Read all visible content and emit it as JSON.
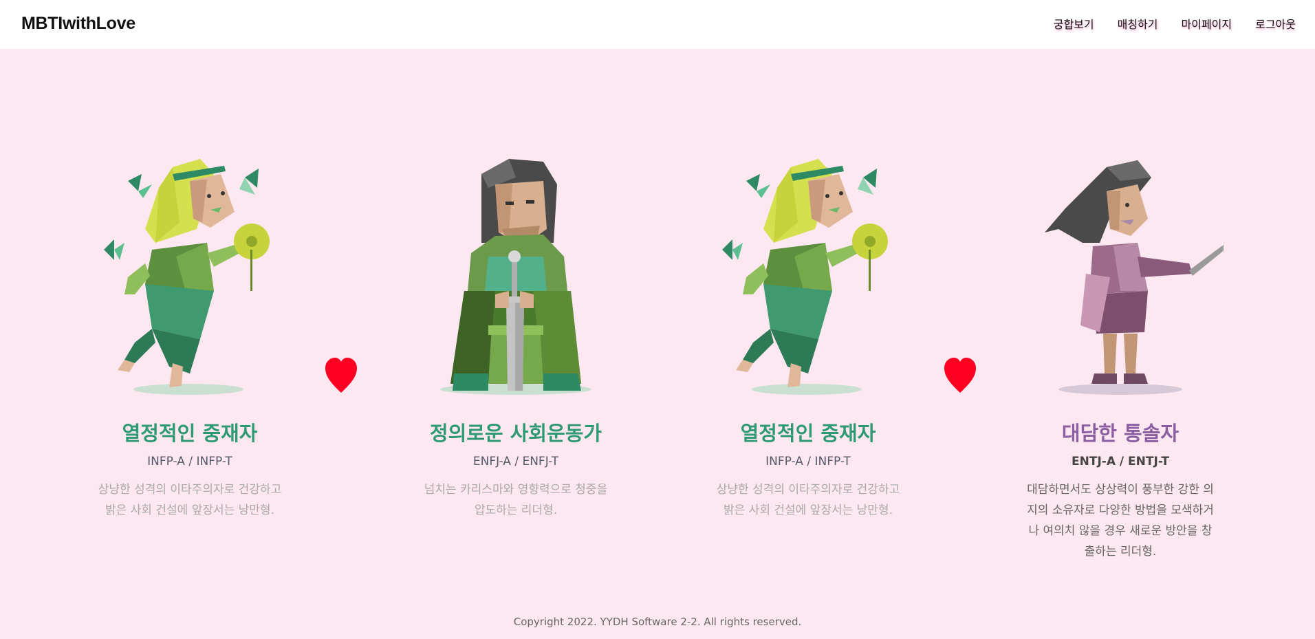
{
  "navbar": {
    "brand": "MBTIwithLove",
    "links": [
      "궁합보기",
      "매칭하기",
      "마이페이지",
      "로그아웃"
    ]
  },
  "cards": [
    {
      "title": "열정적인 중재자",
      "types": "INFP-A / INFP-T",
      "description": "상냥한 성격의 이타주의자로 건강하고 밝은 사회 건설에 앞장서는 낭만형."
    },
    {
      "title": "정의로운 사회운동가",
      "types": "ENFJ-A / ENFJ-T",
      "description": "넘치는 카리스마와 영향력으로 청중을 압도하는 리더형."
    },
    {
      "title": "열정적인 중재자",
      "types": "INFP-A / INFP-T",
      "description": "상냥한 성격의 이타주의자로 건강하고 밝은 사회 건설에 앞장서는 낭만형."
    },
    {
      "title": "대담한 통솔자",
      "types": "ENTJ-A / ENTJ-T",
      "description": "대담하면서도 상상력이 풍부한 강한 의지의 소유자로 다양한 방법을 모색하거나 여의치 않을 경우 새로운 방안을 창출하는 리더형."
    }
  ],
  "footer": {
    "copyright": "Copyright 2022. YYDH Software 2-2. All rights reserved."
  },
  "colors": {
    "background": "#fde7f1",
    "green_title": "#2e9a73",
    "purple_title": "#8a5ea0",
    "heart": "#ff0022"
  },
  "icons": {
    "heart": "heart-icon"
  }
}
